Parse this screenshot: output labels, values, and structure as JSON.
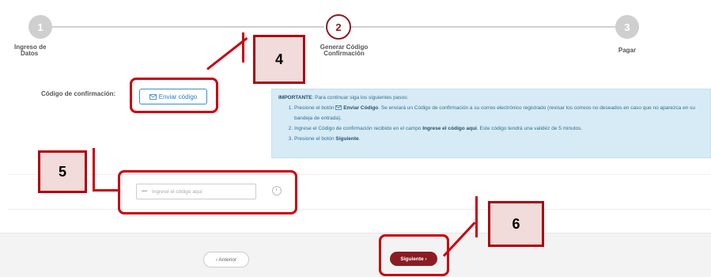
{
  "stepper": {
    "steps": [
      {
        "number": "1",
        "label_line1": "Ingreso de",
        "label_line2": "Datos"
      },
      {
        "number": "2",
        "label_line1": "Generar Código",
        "label_line2": "Confirmación"
      },
      {
        "number": "3",
        "label_line1": "Pagar",
        "label_line2": ""
      }
    ]
  },
  "form": {
    "code_label": "Código de confirmación:",
    "send_button": "Enviar código",
    "code_placeholder": "Ingrese el código aquí",
    "code_dots": "••••"
  },
  "info": {
    "important": "IMPORTANTE",
    "intro": ": Para continuar siga los siguientes pasos:",
    "step1_a": "Presione el botón ",
    "step1_b": "Enviar Código",
    "step1_c": ". Se enviará un Código de confirmación a su correo electrónico registrado (revisar los correos no deseados en caso que no aparezca en su bandeja de entrada).",
    "step2_a": "Ingrese el Código de confirmación recibido en el campo ",
    "step2_b": "Ingrese el código aquí",
    "step2_c": ". Este código tendrá una validéz de 5 minutos.",
    "step3_a": "Presione el botón ",
    "step3_b": "Siguiente",
    "step3_c": "."
  },
  "footer": {
    "prev_label": "‹ Anterior",
    "next_label": "Siguiente ›"
  },
  "annotations": {
    "label4": "4",
    "label5": "5",
    "label6": "6"
  },
  "colors": {
    "brand": "#8b1c24",
    "info_bg": "#d7ebf6",
    "annotation": "#cc0010"
  }
}
